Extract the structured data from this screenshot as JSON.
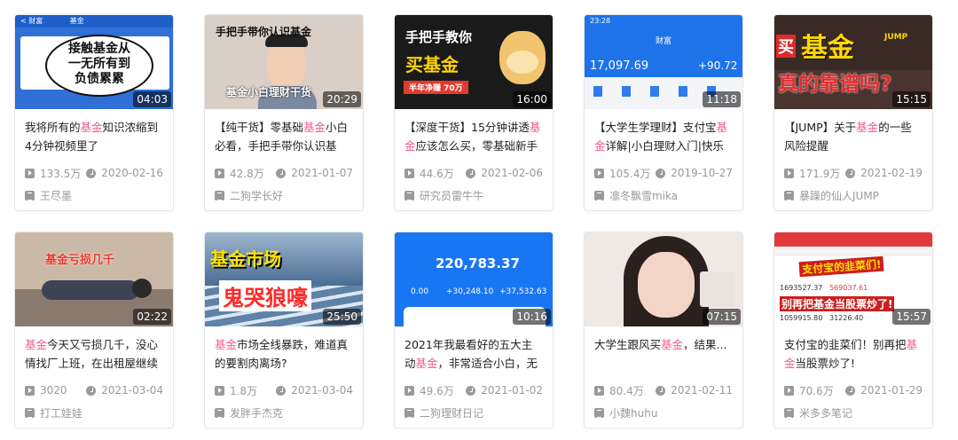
{
  "cards": [
    {
      "duration": "04:03",
      "title_parts": [
        "我将所有的",
        "基金",
        "知识浓缩到4分钟视频里了"
      ],
      "views": "133.5万",
      "date": "2020-02-16",
      "uploader": "王尽墨",
      "thumb_text": [
        "接触基金从",
        "一无所有到",
        "负债累累"
      ]
    },
    {
      "duration": "20:29",
      "title_parts": [
        "【纯干货】零基础",
        "基金",
        "小白必看，手把手带你认识基"
      ],
      "views": "42.8万",
      "date": "2021-01-07",
      "uploader": "二狗学长好",
      "thumb_text": [
        "手把手带你认识基金",
        "基金小白理财干货"
      ]
    },
    {
      "duration": "16:00",
      "title_parts": [
        "【深度干货】15分钟讲透",
        "基金",
        "应该怎么买，零基础新手"
      ],
      "views": "44.6万",
      "date": "2021-02-06",
      "uploader": "研究员雷牛牛",
      "thumb_text": [
        "手把手教你",
        "买基金",
        "半年净赚 70万"
      ]
    },
    {
      "duration": "11:18",
      "title_parts": [
        "【大学生学理财】支付宝",
        "基金",
        "详解|小白理财入门|快乐"
      ],
      "views": "105.4万",
      "date": "2019-10-27",
      "uploader": "凛冬飘雪mika",
      "thumb_text": [
        "23:28",
        "财富",
        "17,097.69",
        "+90.72"
      ]
    },
    {
      "duration": "15:15",
      "title_parts": [
        "【JUMP】关于",
        "基金",
        "的一些风险提醒"
      ],
      "views": "171.9万",
      "date": "2021-02-19",
      "uploader": "暴躁的仙人JUMP",
      "thumb_text": [
        "买",
        "基金",
        "真的靠谱吗?",
        "JUMP"
      ]
    },
    {
      "duration": "02:22",
      "title_parts": [
        "",
        "基金",
        "今天又亏损几千，没心情找厂上班，在出租屋继续"
      ],
      "views": "3020",
      "date": "2021-03-04",
      "uploader": "打工娃娃",
      "thumb_text": [
        "基金亏损几千"
      ]
    },
    {
      "duration": "25:50",
      "title_parts": [
        "",
        "基金",
        "市场全线暴跌，难道真的要割肉离场?"
      ],
      "views": "1.8万",
      "date": "2021-03-04",
      "uploader": "发胖手杰克",
      "thumb_text": [
        "基金市场",
        "鬼哭狼嚎"
      ]
    },
    {
      "duration": "10:16",
      "title_parts": [
        "2021年我最看好的五大主动",
        "基金",
        "，非常适合小白，无需"
      ],
      "views": "49.6万",
      "date": "2021-01-02",
      "uploader": "二狗理财日记",
      "thumb_text": [
        "220,783.37",
        "0.00",
        "+30,248.10",
        "+37,532.63"
      ]
    },
    {
      "duration": "07:15",
      "title_parts": [
        "大学生跟风买",
        "基金",
        "，结果..."
      ],
      "views": "80.4万",
      "date": "2021-02-11",
      "uploader": "小魏huhu",
      "thumb_text": []
    },
    {
      "duration": "15:57",
      "title_parts": [
        "支付宝的韭菜们！别再把",
        "基金",
        "当股票炒了!"
      ],
      "views": "70.6万",
      "date": "2021-01-29",
      "uploader": "米多多笔记",
      "thumb_text": [
        "支付宝的韭菜们!",
        "别再把基金当股票炒了!",
        "1693527.37",
        "569037.61",
        "1059915.80",
        "31226.40"
      ]
    }
  ],
  "colors": {
    "keyword": "#f25d8e",
    "meta": "#999999"
  }
}
